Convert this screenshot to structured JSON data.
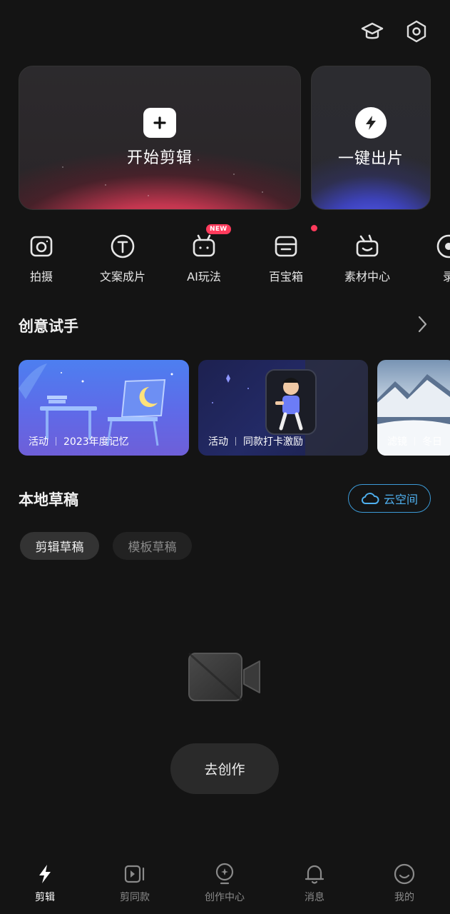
{
  "header": {
    "icons": [
      "graduation-cap-icon",
      "settings-hexagon-icon"
    ]
  },
  "hero": {
    "main_label": "开始剪辑",
    "side_label": "一键出片"
  },
  "tools": [
    {
      "label": "拍摄",
      "icon": "camera-icon"
    },
    {
      "label": "文案成片",
      "icon": "text-circle-icon"
    },
    {
      "label": "AI玩法",
      "icon": "robot-icon",
      "badge": "NEW"
    },
    {
      "label": "百宝箱",
      "icon": "toolbox-icon"
    },
    {
      "label": "素材中心",
      "icon": "clapper-icon"
    },
    {
      "label": "录",
      "icon": "record-icon"
    }
  ],
  "creative": {
    "title": "创意试手",
    "cards": [
      {
        "tag": "活动",
        "title": "2023年度记忆"
      },
      {
        "tag": "活动",
        "title": "同款打卡激励"
      },
      {
        "tag": "滤镜",
        "title": "冬日"
      }
    ]
  },
  "drafts": {
    "title": "本地草稿",
    "cloud_label": "云空间",
    "tabs": [
      "剪辑草稿",
      "模板草稿"
    ],
    "active_tab": "剪辑草稿",
    "create_label": "去创作"
  },
  "bottom_nav": [
    {
      "label": "剪辑",
      "icon": "bolt-icon",
      "active": true
    },
    {
      "label": "剪同款",
      "icon": "play-template-icon"
    },
    {
      "label": "创作中心",
      "icon": "bulb-icon"
    },
    {
      "label": "消息",
      "icon": "bell-icon"
    },
    {
      "label": "我的",
      "icon": "smile-icon"
    }
  ],
  "colors": {
    "background": "#141414",
    "accent_red": "#ef4a61",
    "accent_blue": "#5860ff",
    "cloud_blue": "#4fb0ef",
    "badge_red": "#ff3b5c"
  }
}
